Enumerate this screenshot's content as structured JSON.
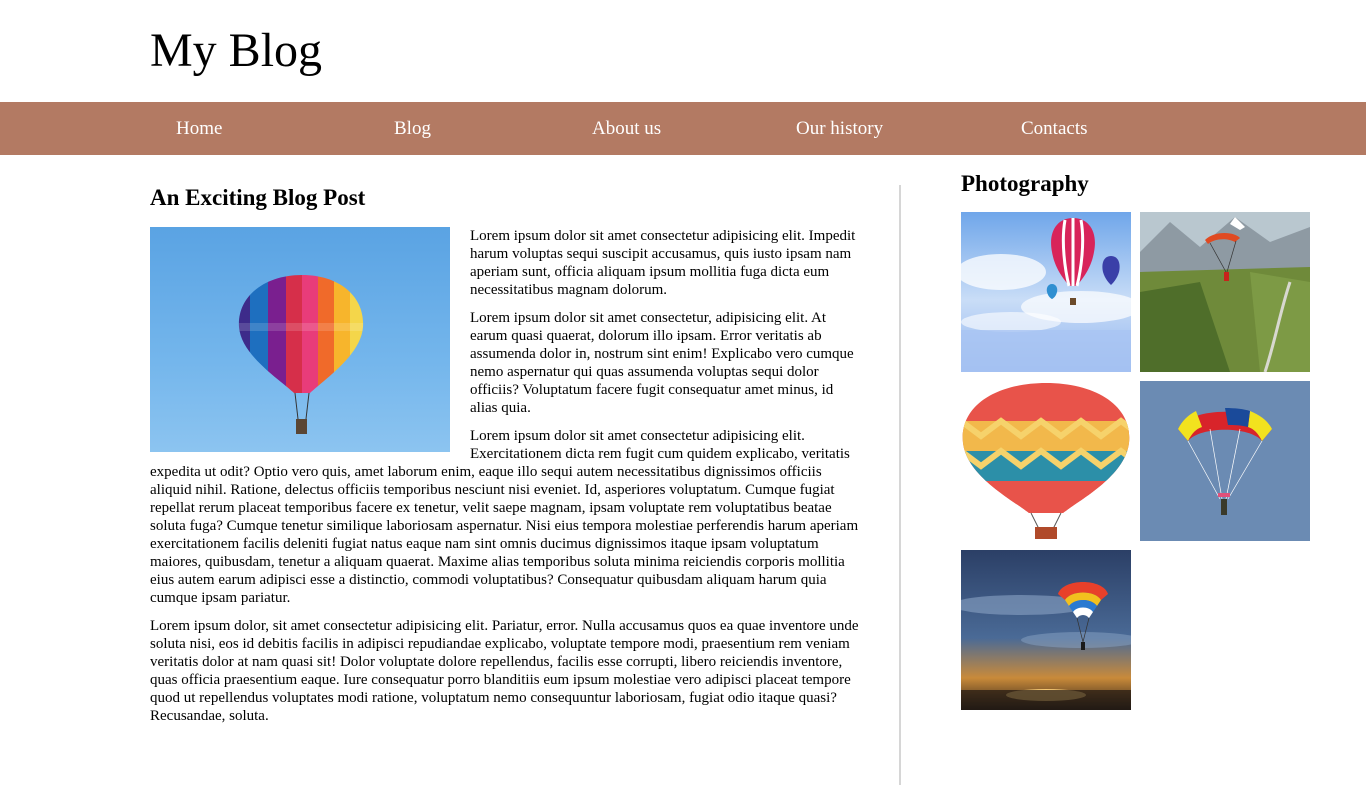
{
  "header": {
    "title": "My Blog"
  },
  "nav": {
    "color": "#b37a63",
    "items": [
      {
        "label": "Home"
      },
      {
        "label": "Blog"
      },
      {
        "label": "About us"
      },
      {
        "label": "Our history"
      },
      {
        "label": "Contacts"
      }
    ]
  },
  "post": {
    "title": "An Exciting Blog Post",
    "image": "hot-air-balloon-photo",
    "paragraphs": [
      "Lorem ipsum dolor sit amet consectetur adipisicing elit. Impedit harum voluptas sequi suscipit accusamus, quis iusto ipsam nam aperiam sunt, officia aliquam ipsum mollitia fuga dicta eum necessitatibus magnam dolorum.",
      "Lorem ipsum dolor sit amet consectetur, adipisicing elit. At earum quasi quaerat, dolorum illo ipsam. Error veritatis ab assumenda dolor in, nostrum sint enim! Explicabo vero cumque nemo aspernatur qui quas assumenda voluptas sequi dolor officiis? Voluptatum facere fugit consequatur amet minus, id alias quia.",
      "Lorem ipsum dolor sit amet consectetur adipisicing elit. Exercitationem dicta rem fugit cum quidem explicabo, veritatis expedita ut odit? Optio vero quis, amet laborum enim, eaque illo sequi autem necessitatibus dignissimos officiis aliquid nihil. Ratione, delectus officiis temporibus nesciunt nisi eveniet. Id, asperiores voluptatum. Cumque fugiat repellat rerum placeat temporibus facere ex tenetur, velit saepe magnam, ipsam voluptate rem voluptatibus beatae soluta fuga? Cumque tenetur similique laboriosam aspernatur. Nisi eius tempora molestiae perferendis harum aperiam exercitationem facilis deleniti fugiat natus eaque nam sint omnis ducimus dignissimos itaque ipsam voluptatum maiores, quibusdam, tenetur a aliquam quaerat. Maxime alias temporibus soluta minima reiciendis corporis mollitia eius autem earum adipisci esse a distinctio, commodi voluptatibus? Consequatur quibusdam aliquam harum quia cumque ipsam pariatur.",
      "Lorem ipsum dolor, sit amet consectetur adipisicing elit. Pariatur, error. Nulla accusamus quos ea quae inventore unde soluta nisi, eos id debitis facilis in adipisci repudiandae explicabo, voluptate tempore modi, praesentium rem veniam veritatis dolor at nam quasi sit! Dolor voluptate dolore repellendus, facilis esse corrupti, libero reiciendis inventore, quas officia praesentium eaque. Iure consequatur porro blanditiis eum ipsum molestiae vero adipisci placeat tempore quod ut repellendus voluptates modi ratione, voluptatum nemo consequuntur laboriosam, fugiat odio itaque quasi? Recusandae, soluta."
    ]
  },
  "sidebar": {
    "title": "Photography",
    "photos": [
      "balloons-over-clouds-photo",
      "paraglider-over-valley-photo",
      "hot-air-balloon-closeup-photo",
      "parachutist-photo",
      "parachute-at-sunset-photo"
    ]
  }
}
